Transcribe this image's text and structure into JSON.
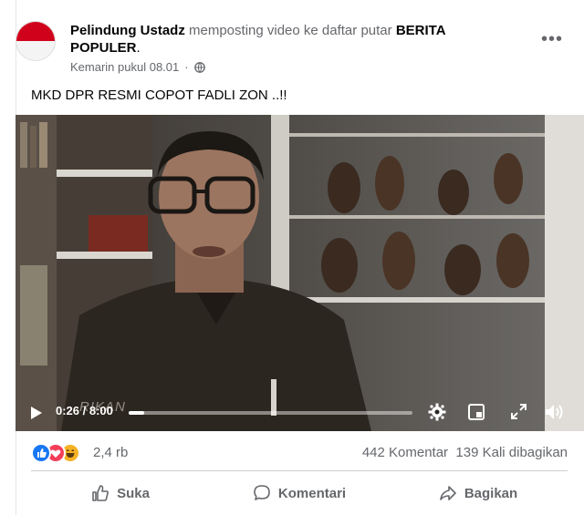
{
  "post": {
    "author": "Pelindung Ustadz",
    "action_text": " memposting video ke daftar putar ",
    "playlist_line1": "BERITA",
    "playlist_line2": "POPULER",
    "playlist_suffix": ".",
    "timestamp": "Kemarin pukul 08.01",
    "privacy_icon": "globe-icon",
    "more_icon": "ellipsis-icon",
    "caption": "MKD DPR RESMI COPOT FADLI ZON ..!!"
  },
  "video": {
    "watermark": "RIKAN",
    "current_time": "0:26",
    "separator": " / ",
    "duration": "8:00",
    "progress": 0.054
  },
  "stats": {
    "reactions": [
      "like",
      "love",
      "haha"
    ],
    "reaction_colors": {
      "like": "#1877f2",
      "love": "#f33e58",
      "haha": "#f7b125"
    },
    "reaction_count": "2,4 rb",
    "comments": "442 Komentar",
    "shares": "139 Kali dibagikan"
  },
  "actions": {
    "like": "Suka",
    "comment": "Komentari",
    "share": "Bagikan"
  }
}
